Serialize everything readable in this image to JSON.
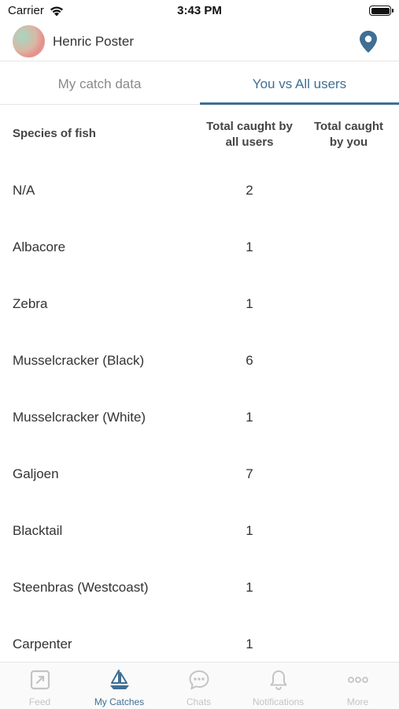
{
  "status_bar": {
    "carrier": "Carrier",
    "time": "3:43 PM"
  },
  "profile": {
    "name": "Henric Poster"
  },
  "tabs": [
    {
      "label": "My catch data",
      "active": false
    },
    {
      "label": "You vs All users",
      "active": true
    }
  ],
  "table": {
    "headers": {
      "species": "Species of fish",
      "total_all_line1": "Total caught by",
      "total_all_line2": "all users",
      "total_you_line1": "Total caught",
      "total_you_line2": "by you"
    },
    "rows": [
      {
        "species": "N/A",
        "total_all": "2",
        "total_you": ""
      },
      {
        "species": "Albacore",
        "total_all": "1",
        "total_you": ""
      },
      {
        "species": "Zebra",
        "total_all": "1",
        "total_you": ""
      },
      {
        "species": "Musselcracker (Black)",
        "total_all": "6",
        "total_you": ""
      },
      {
        "species": "Musselcracker (White)",
        "total_all": "1",
        "total_you": ""
      },
      {
        "species": "Galjoen",
        "total_all": "7",
        "total_you": ""
      },
      {
        "species": "Blacktail",
        "total_all": "1",
        "total_you": ""
      },
      {
        "species": "Steenbras (Westcoast)",
        "total_all": "1",
        "total_you": ""
      },
      {
        "species": "Carpenter",
        "total_all": "1",
        "total_you": ""
      }
    ]
  },
  "tabbar": {
    "items": [
      {
        "label": "Feed",
        "icon": "feed-icon",
        "active": false
      },
      {
        "label": "My Catches",
        "icon": "sailboat-icon",
        "active": true
      },
      {
        "label": "Chats",
        "icon": "chat-icon",
        "active": false
      },
      {
        "label": "Notifications",
        "icon": "bell-icon",
        "active": false
      },
      {
        "label": "More",
        "icon": "more-icon",
        "active": false
      }
    ]
  },
  "colors": {
    "accent": "#3f6f94",
    "inactive": "#c4c4c4",
    "text": "#333333"
  }
}
